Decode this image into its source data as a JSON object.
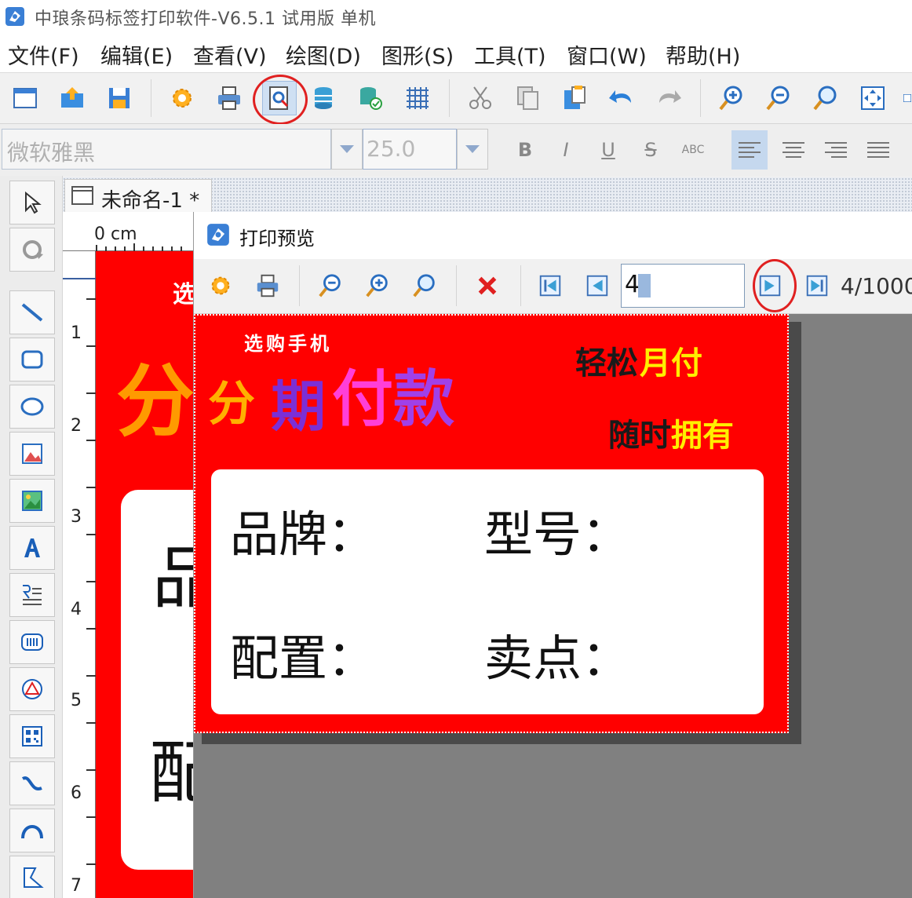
{
  "window": {
    "title": "中琅条码标签打印软件-V6.5.1 试用版 单机"
  },
  "menu": [
    {
      "label": "文件(F)"
    },
    {
      "label": "编辑(E)"
    },
    {
      "label": "查看(V)"
    },
    {
      "label": "绘图(D)"
    },
    {
      "label": "图形(S)"
    },
    {
      "label": "工具(T)"
    },
    {
      "label": "窗口(W)"
    },
    {
      "label": "帮助(H)"
    }
  ],
  "fontbar": {
    "font_name": "微软雅黑",
    "font_size": "25.0",
    "bold": "B",
    "italic": "I",
    "underline": "U",
    "strike": "S",
    "abc": "ABC"
  },
  "document": {
    "tab_label": "未命名-1 *",
    "ruler_unit": "0 cm",
    "ruler_marks": [
      "1",
      "2",
      "3",
      "4",
      "5",
      "6",
      "7"
    ],
    "label_top_text": "选",
    "label_big_text": "分",
    "label_char_1": "品",
    "label_char_2": "配"
  },
  "preview": {
    "title": "打印预览",
    "page_input": "4",
    "page_count": "4/1000",
    "label": {
      "top_text": "选购手机",
      "fen": "分",
      "qi": "期",
      "fu": "付",
      "kuan": "款",
      "easy_a": "轻松",
      "easy_b": "月付",
      "own_a": "随时",
      "own_b": "拥有",
      "brand": "品牌：",
      "model": "型号：",
      "config": "配置：",
      "selling_point": "卖点："
    }
  },
  "colors": {
    "label_red": "#ff0000",
    "highlight_ring": "#e02020",
    "yellow_text": "#ffee00",
    "orange_text": "#ffb000"
  },
  "icons": {
    "toolbar": [
      "new-icon",
      "open-icon",
      "save-icon",
      "settings-icon",
      "print-icon",
      "print-preview-icon",
      "database-icon",
      "database-settings-icon",
      "grid-icon",
      "cut-icon",
      "copy-icon",
      "paste-icon",
      "undo-icon",
      "redo-icon",
      "zoom-in-icon",
      "zoom-out-icon",
      "zoom-actual-icon",
      "fit-page-icon"
    ],
    "preview_toolbar": [
      "settings-icon",
      "print-icon",
      "zoom-out-icon",
      "zoom-in-icon",
      "zoom-actual-icon",
      "close-icon",
      "first-page-icon",
      "previous-page-icon",
      "next-page-icon",
      "last-page-icon"
    ]
  }
}
